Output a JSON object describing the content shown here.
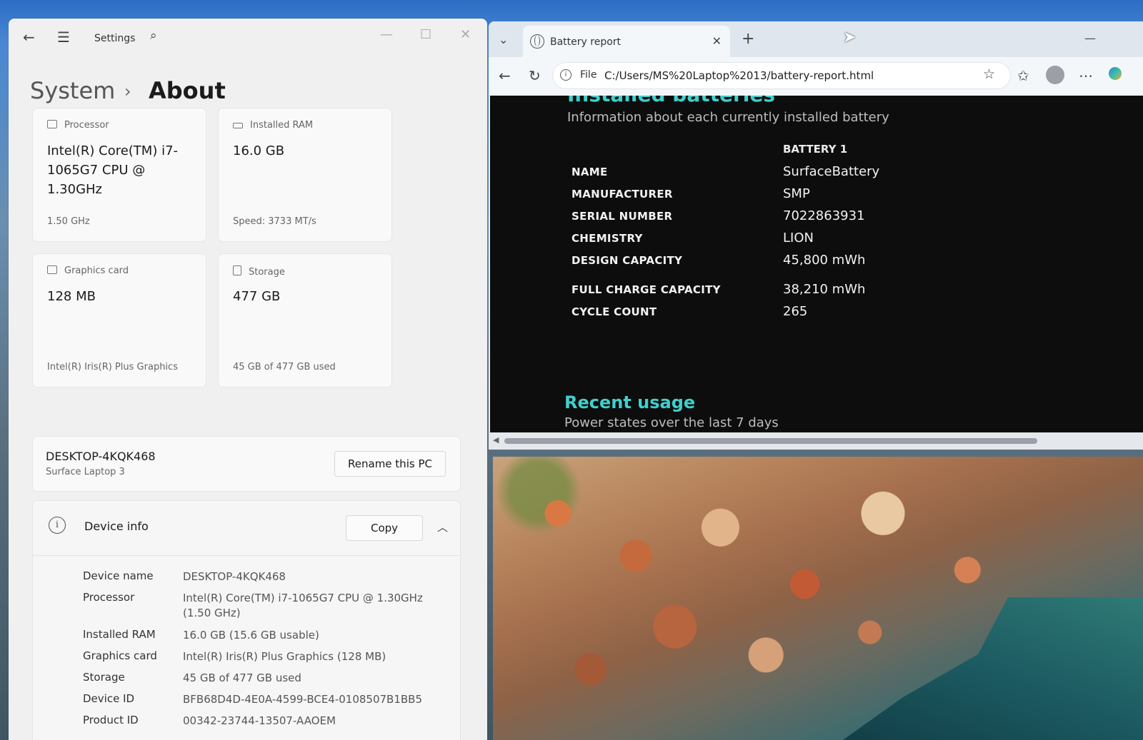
{
  "settings": {
    "title": "Settings",
    "breadcrumb": {
      "parent": "System",
      "separator": "›",
      "current": "About"
    },
    "cards": {
      "processor": {
        "header": "Processor",
        "value": "Intel(R) Core(TM) i7-1065G7 CPU @ 1.30GHz",
        "sub": "1.50 GHz"
      },
      "ram": {
        "header": "Installed RAM",
        "value": "16.0 GB",
        "sub": "Speed: 3733 MT/s"
      },
      "graphics": {
        "header": "Graphics card",
        "value": "128 MB",
        "sub": "Intel(R) Iris(R) Plus Graphics"
      },
      "storage": {
        "header": "Storage",
        "value": "477 GB",
        "sub": "45 GB of 477 GB used"
      }
    },
    "pc": {
      "name": "DESKTOP-4KQK468",
      "model": "Surface Laptop 3",
      "rename_label": "Rename this PC"
    },
    "device_info": {
      "title": "Device info",
      "copy_label": "Copy",
      "specs": [
        {
          "label": "Device name",
          "value": "DESKTOP-4KQK468"
        },
        {
          "label": "Processor",
          "value": "Intel(R) Core(TM) i7-1065G7 CPU @ 1.30GHz (1.50 GHz)"
        },
        {
          "label": "Installed RAM",
          "value": "16.0 GB (15.6 GB usable)"
        },
        {
          "label": "Graphics card",
          "value": "Intel(R) Iris(R) Plus Graphics (128 MB)"
        },
        {
          "label": "Storage",
          "value": "45 GB of 477 GB used"
        },
        {
          "label": "Device ID",
          "value": "BFB68D4D-4E0A-4599-BCE4-0108507B1BB5"
        },
        {
          "label": "Product ID",
          "value": "00342-23744-13507-AAOEM"
        }
      ]
    }
  },
  "browser": {
    "tab_title": "Battery report",
    "address": {
      "scheme": "File",
      "url": "C:/Users/MS%20Laptop%2013/battery-report.html"
    },
    "report": {
      "section_title": "Installed batteries",
      "section_sub": "Information about each currently installed battery",
      "column_header": "BATTERY 1",
      "rows": [
        {
          "label": "NAME",
          "value": "SurfaceBattery"
        },
        {
          "label": "MANUFACTURER",
          "value": "SMP"
        },
        {
          "label": "SERIAL NUMBER",
          "value": "7022863931"
        },
        {
          "label": "CHEMISTRY",
          "value": "LION"
        },
        {
          "label": "DESIGN CAPACITY",
          "value": "45,800 mWh"
        },
        {
          "label": "FULL CHARGE CAPACITY",
          "value": "38,210 mWh"
        },
        {
          "label": "CYCLE COUNT",
          "value": "265"
        }
      ],
      "recent_title": "Recent usage",
      "recent_sub": "Power states over the last 7 days"
    }
  }
}
